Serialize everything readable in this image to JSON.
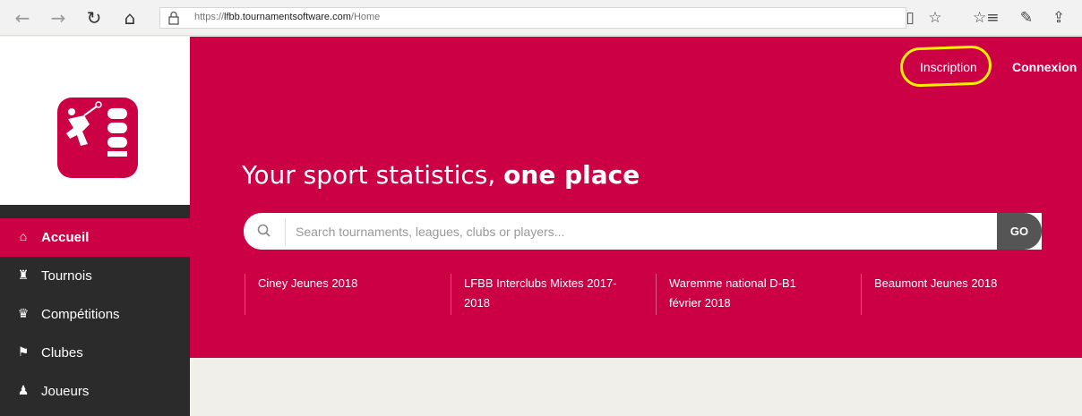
{
  "browser": {
    "url_prefix": "https://",
    "url_host": "lfbb.tournamentsoftware.com",
    "url_path": "/Home",
    "back_icon": "←",
    "forward_icon": "→",
    "refresh_icon": "↻",
    "home_icon": "⌂",
    "reading_icon": "▯",
    "fav_icon": "☆",
    "favlist_icon": "☆≡",
    "pen_icon": "✎",
    "share_icon": "⇪"
  },
  "header": {
    "register_label": "Inscription",
    "login_label": "Connexion"
  },
  "sidebar": {
    "brand": "lfbb",
    "items": [
      {
        "label": "Accueil",
        "icon": "home-icon",
        "glyph": "⌂"
      },
      {
        "label": "Tournois",
        "icon": "trophy-cup-icon",
        "glyph": "♜"
      },
      {
        "label": "Compétitions",
        "icon": "trophy-icon",
        "glyph": "♛"
      },
      {
        "label": "Clubes",
        "icon": "flag-icon",
        "glyph": "⚑"
      },
      {
        "label": "Joueurs",
        "icon": "users-icon",
        "glyph": "♟"
      }
    ]
  },
  "hero": {
    "title_normal": "Your sport statistics, ",
    "title_bold": "one place",
    "search_placeholder": "Search tournaments, leagues, clubs or players...",
    "go_label": "GO",
    "quick_links": [
      {
        "line1": "Ciney Jeunes 2018",
        "line2": ""
      },
      {
        "line1": "LFBB Interclubs Mixtes 2017-",
        "line2": "2018"
      },
      {
        "line1": "Waremme national D-B1",
        "line2": "février 2018"
      },
      {
        "line1": "Beaumont Jeunes 2018",
        "line2": ""
      }
    ]
  },
  "colors": {
    "brand": "#cc0044",
    "sidebar_dark": "#2b2b2b",
    "highlight": "#f7f000"
  }
}
